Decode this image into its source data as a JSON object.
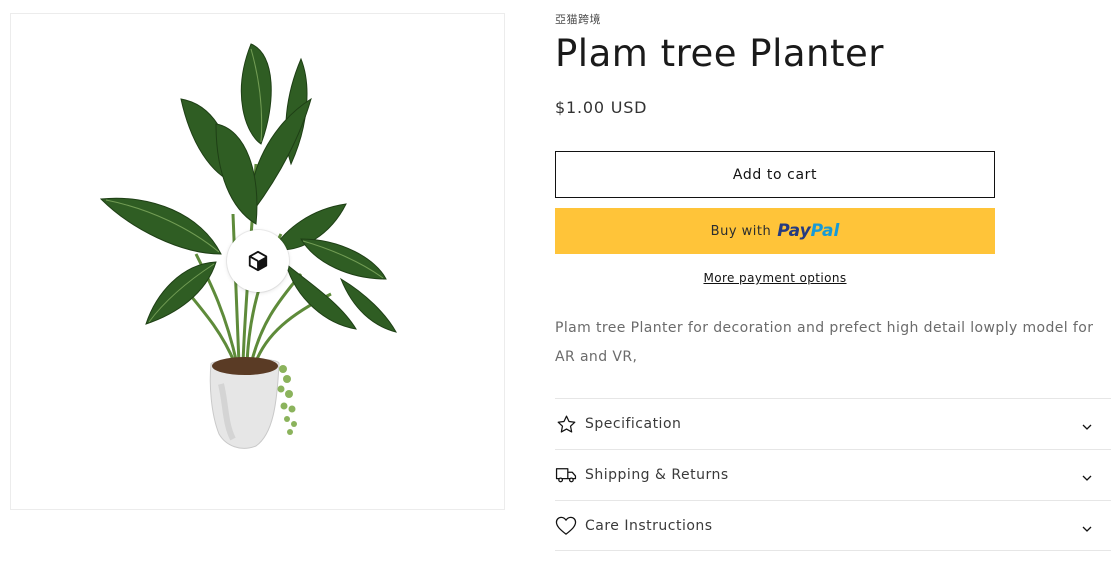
{
  "product": {
    "vendor": "亞猫跨境",
    "title": "Plam tree Planter",
    "price": "$1.00 USD",
    "description": "Plam tree Planter for decoration and prefect high detail lowply model for AR and VR,"
  },
  "buttons": {
    "add_to_cart": "Add to cart",
    "buy_with": "Buy with",
    "paypal_part1": "Pay",
    "paypal_part2": "Pal",
    "more_payment_options": "More payment options"
  },
  "accordion": [
    {
      "label": "Specification",
      "icon": "star-icon"
    },
    {
      "label": "Shipping & Returns",
      "icon": "truck-icon"
    },
    {
      "label": "Care Instructions",
      "icon": "heart-icon"
    }
  ],
  "colors": {
    "paypal_yellow": "#ffc439",
    "paypal_dark_blue": "#253b80",
    "paypal_light_blue": "#179bd7"
  }
}
